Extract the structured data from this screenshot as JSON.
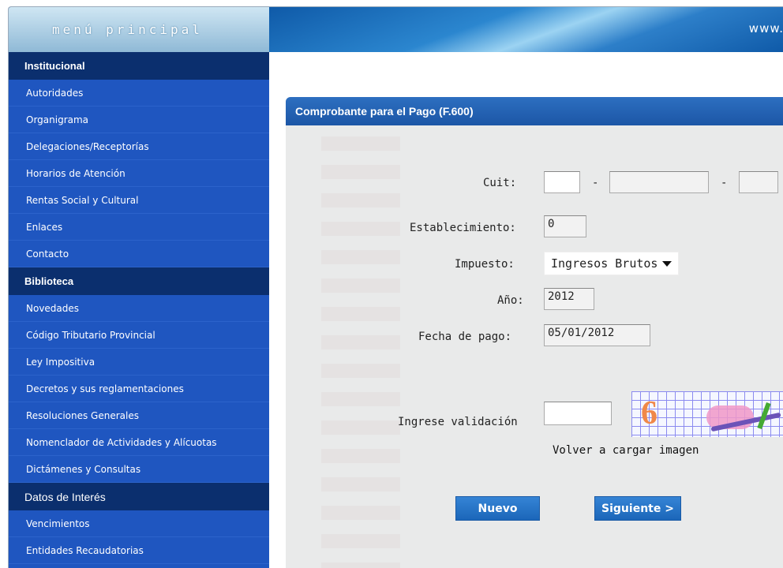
{
  "sidebar": {
    "header": "menú principal",
    "sections": [
      {
        "title": "Institucional",
        "items": [
          "Autoridades",
          "Organigrama",
          "Delegaciones/Receptorías",
          "Horarios de Atención",
          "Rentas Social y Cultural",
          "Enlaces",
          "Contacto"
        ]
      },
      {
        "title": "Biblioteca",
        "items": [
          "Novedades",
          "Código Tributario Provincial",
          "Ley Impositiva",
          "Decretos y sus reglamentaciones",
          "Resoluciones Generales",
          "Nomenclador de Actividades y Alícuotas",
          "Dictámenes y Consultas"
        ]
      },
      {
        "title": "Datos de Interés",
        "items": [
          "Vencimientos",
          "Entidades Recaudatorias"
        ]
      }
    ]
  },
  "banner": {
    "url_text": "www."
  },
  "form": {
    "title": "Comprobante para el Pago (F.600)",
    "cuit_label": "Cuit:",
    "cuit_part1": "",
    "cuit_part2": "",
    "cuit_part3": "",
    "cuit_separator": "-",
    "establecimiento_label": "Establecimiento:",
    "establecimiento_value": "0",
    "impuesto_label": "Impuesto:",
    "impuesto_selected": "Ingresos Brutos",
    "anio_label": "Año:",
    "anio_value": "2012",
    "fecha_label": "Fecha de pago:",
    "fecha_value": "05/01/2012",
    "validacion_label": "Ingrese validación",
    "validacion_value": "",
    "reload_text": "Volver a cargar imagen",
    "nuevo_button": "Nuevo",
    "siguiente_button": "Siguiente >"
  },
  "colors": {
    "sidebar_item_bg": "#1f56c0",
    "sidebar_section_bg": "#0b2f6e",
    "panel_header_bg": "#1c56a6",
    "button_bg": "#1b66b9"
  }
}
